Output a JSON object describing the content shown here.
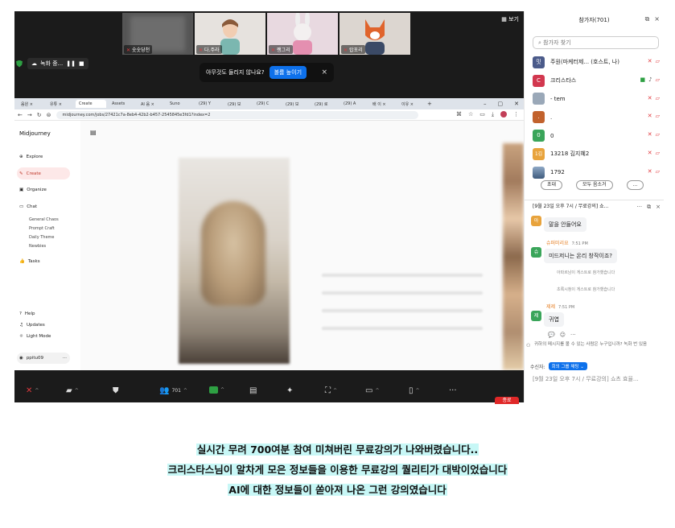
{
  "zoom": {
    "view_label": "보기",
    "gallery": [
      {
        "name": "숫숫당천",
        "color": "#5a5a5a"
      },
      {
        "name": "다.주라",
        "color": "#d7d3cf"
      },
      {
        "name": "쨍그리",
        "color": "#d9c7cf"
      },
      {
        "name": "랍포리",
        "color": "#ddd6cf"
      }
    ],
    "recording_label": "녹화 중...",
    "toast": {
      "text": "아무것도 들리지 않나요?",
      "button": "볼륨 높이기"
    },
    "toolbar": {
      "participants_count": "701",
      "end_label": "종료"
    }
  },
  "browser": {
    "tabs": [
      "음원 ×",
      "유튜 ×",
      "Create",
      "Assets",
      "AI 음 ×",
      "Suno",
      "(29) Y",
      "(29) 보",
      "(29) C",
      "(29) 보",
      "(29) 로",
      "(29) A",
      "배 이 ×",
      "이유 ×"
    ],
    "url": "midjourney.com/jobs/27421c7a-8eb4-42b2-b457-2545845e3fd1?index=2"
  },
  "midjourney": {
    "logo": "Midjourney",
    "nav": [
      "Explore",
      "Create",
      "Organize",
      "Chat"
    ],
    "chat_subs": [
      "General Chaos",
      "Prompt Craft",
      "Daily Theme",
      "Newbies"
    ],
    "tasks": "Tasks",
    "bottom": [
      "Help",
      "Updates",
      "Light Mode"
    ],
    "user": "ppitu09"
  },
  "panel": {
    "title": "참가자(701)",
    "search_placeholder": "참가자 찾기",
    "participants": [
      {
        "avatar": "밋",
        "name": "주원(마케터제...  (호스트, 나)",
        "color": "#4b5b8a"
      },
      {
        "avatar": "C",
        "name": "크리스타스",
        "color": "#d2384f"
      },
      {
        "avatar": "",
        "name": "- tem",
        "color": "#9aa8b8"
      },
      {
        "avatar": ".",
        "name": ".",
        "color": "#c2622d"
      },
      {
        "avatar": "0",
        "name": "0",
        "color": "#3aa55a"
      },
      {
        "avatar": "1김",
        "name": "13218 김지혜2",
        "color": "#e8a33c"
      },
      {
        "avatar": "",
        "name": "1792",
        "color": "#6a88a8"
      }
    ],
    "invite_label": "초대",
    "mute_all_label": "모두 음소거",
    "more_label": "...",
    "chat_title": "[9월 23일 오후 7시 / 무료강의] 쇼...",
    "messages": {
      "m1_avatar": "아",
      "m1_text": "말을 안들어요",
      "m2_author": "슈퍼미리요",
      "m2_time": "7:51 PM",
      "m2_avatar": "슈",
      "m2_text": "미드저니는 온리 창작이죠?",
      "sys1": "아파르남이 게스트로 참가했습니다",
      "sys2": "초록시청이 게스트로 참가했습니다",
      "m3_author": "제제",
      "m3_time": "7:51 PM",
      "m3_avatar": "제",
      "m3_text": "귀엽"
    },
    "notice": "귀하의 메시지를 볼 수 있는 사람은 누구입니까? 녹화 번 있음",
    "recipient_label": "수신자:",
    "recipient_value": "회의 그룹 채팅",
    "compose": "[9월 23일 오후 7시 / 무료강의] 쇼츠 효율..."
  },
  "caption": [
    "실시간 무려 700여분 참여 미쳐버린 무료강의가 나와버렸습니다..",
    "크리스타스님이 알차게 모은 정보들을 이용한 무료강의 퀄리티가 대박이었습니다",
    "AI에 대한 정보들이 쏟아져 나온 그런 강의였습니다"
  ]
}
